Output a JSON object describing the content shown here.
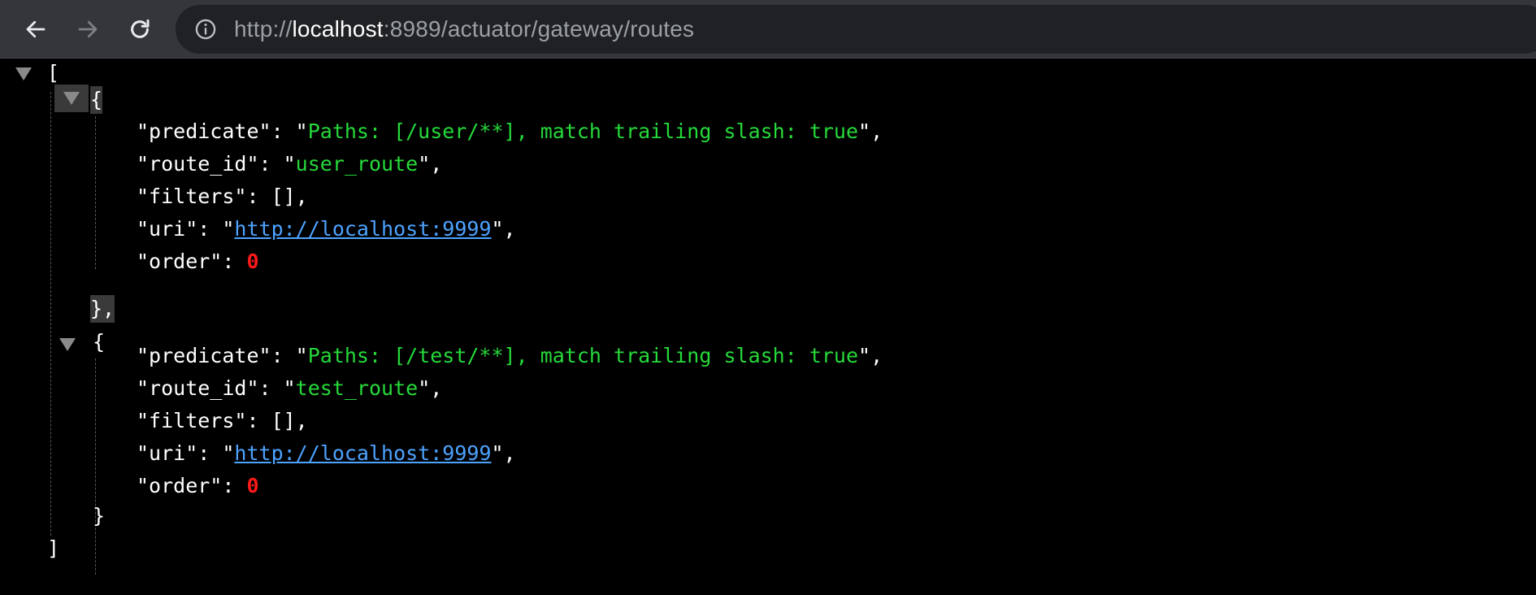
{
  "browser": {
    "url_scheme": "http://",
    "url_host": "localhost",
    "url_path": ":8989/actuator/gateway/routes"
  },
  "json": {
    "open_bracket": "[",
    "close_bracket": "]",
    "routes": [
      {
        "open": "{",
        "close": "},",
        "predicate_key": "\"predicate\": \"",
        "predicate_value": "Paths: [/user/**], match trailing slash: true",
        "predicate_end": "\",",
        "route_id_key": "\"route_id\": \"",
        "route_id_value": "user_route",
        "route_id_end": "\",",
        "filters_line": "\"filters\": [],",
        "uri_key": "\"uri\": \"",
        "uri_value": "http://localhost:9999",
        "uri_end": "\",",
        "order_key": "\"order\": ",
        "order_value": "0"
      },
      {
        "open": "{",
        "close": "}",
        "predicate_key": "\"predicate\": \"",
        "predicate_value": "Paths: [/test/**], match trailing slash: true",
        "predicate_end": "\",",
        "route_id_key": "\"route_id\": \"",
        "route_id_value": "test_route",
        "route_id_end": "\",",
        "filters_line": "\"filters\": [],",
        "uri_key": "\"uri\": \"",
        "uri_value": "http://localhost:9999",
        "uri_end": "\",",
        "order_key": "\"order\": ",
        "order_value": "0"
      }
    ]
  },
  "colors": {
    "string": "#26d93a",
    "number": "#ff1a1a",
    "link": "#4da3ff",
    "background": "#000000"
  },
  "icons": [
    "back-arrow-icon",
    "forward-arrow-icon",
    "reload-icon",
    "info-icon",
    "collapse-triangle-icon"
  ]
}
